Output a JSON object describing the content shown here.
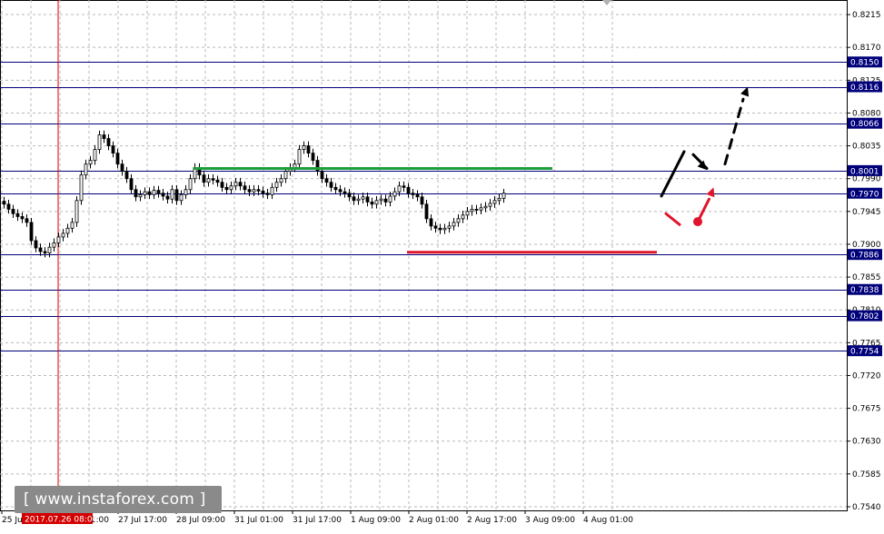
{
  "chart_data": {
    "type": "candlestick",
    "instrument": "",
    "ylim": [
      0.7535,
      0.8235
    ],
    "x_tick_labels": [
      "25 Jul 2017",
      "27 Jul 01:00",
      "27 Jul 17:00",
      "28 Jul 09:00",
      "31 Jul 01:00",
      "31 Jul 17:00",
      "1 Aug 09:00",
      "2 Aug 01:00",
      "2 Aug 17:00",
      "3 Aug 09:00",
      "4 Aug 01:00"
    ],
    "y_tick_labels": [
      "0.8215",
      "0.8170",
      "0.8125",
      "0.8080",
      "0.8035",
      "0.7990",
      "0.7945",
      "0.7900",
      "0.7855",
      "0.7810",
      "0.7765",
      "0.7720",
      "0.7675",
      "0.7630",
      "0.7585",
      "0.7540"
    ],
    "level_labels": [
      "0.8150",
      "0.8116",
      "0.8066",
      "0.8001",
      "0.7970",
      "0.7886",
      "0.7838",
      "0.7802",
      "0.7754"
    ],
    "cursor_time_label": "2017.07.26 08:00",
    "price_series": [
      0.7955,
      0.7948,
      0.7942,
      0.7938,
      0.7935,
      0.793,
      0.7905,
      0.7895,
      0.789,
      0.7888,
      0.7896,
      0.7902,
      0.791,
      0.7915,
      0.7922,
      0.793,
      0.796,
      0.7995,
      0.801,
      0.8015,
      0.803,
      0.805,
      0.8045,
      0.8035,
      0.8025,
      0.801,
      0.8,
      0.799,
      0.7975,
      0.7965,
      0.7968,
      0.7972,
      0.7968,
      0.7974,
      0.797,
      0.7966,
      0.7962,
      0.7975,
      0.796,
      0.7968,
      0.7975,
      0.799,
      0.8005,
      0.7995,
      0.7985,
      0.799,
      0.7988,
      0.7985,
      0.7978,
      0.7975,
      0.798,
      0.7985,
      0.798,
      0.7975,
      0.7972,
      0.7975,
      0.7973,
      0.797,
      0.7968,
      0.7978,
      0.7985,
      0.799,
      0.8,
      0.8005,
      0.801,
      0.803,
      0.8035,
      0.8025,
      0.8015,
      0.8,
      0.799,
      0.7985,
      0.7978,
      0.7975,
      0.7972,
      0.797,
      0.7965,
      0.796,
      0.7962,
      0.7965,
      0.7958,
      0.7955,
      0.796,
      0.7962,
      0.7958,
      0.7966,
      0.7972,
      0.798,
      0.7978,
      0.797,
      0.7968,
      0.7965,
      0.7955,
      0.7935,
      0.7925,
      0.7922,
      0.792,
      0.7922,
      0.7925,
      0.793,
      0.7935,
      0.794,
      0.7945,
      0.7948,
      0.7947,
      0.795,
      0.7952,
      0.7956,
      0.796,
      0.7963,
      0.797
    ],
    "horizontal_levels": [
      {
        "price": 0.815,
        "color": "#00007a"
      },
      {
        "price": 0.8116,
        "color": "#00007a"
      },
      {
        "price": 0.8066,
        "color": "#00007a"
      },
      {
        "price": 0.8001,
        "color": "#00007a"
      },
      {
        "price": 0.797,
        "color": "#00007a"
      },
      {
        "price": 0.7886,
        "color": "#00007a"
      },
      {
        "price": 0.7838,
        "color": "#00007a"
      },
      {
        "price": 0.7802,
        "color": "#00007a"
      },
      {
        "price": 0.7754,
        "color": "#00007a"
      }
    ],
    "support_resistance": [
      {
        "kind": "resistance",
        "price": 0.8004,
        "from_index": 42,
        "to_index": 121,
        "color": "#1e9e3a"
      },
      {
        "kind": "support",
        "price": 0.7889,
        "from_index": 89,
        "to_index": 144,
        "color": "#e0152c"
      }
    ],
    "colors": {
      "bull_candle": "#ffffff",
      "bear_candle": "#000000",
      "level_label_bg": "#00007a",
      "grid": "#b9b9b9",
      "cursor_line": "#d40000",
      "scenario_up": "#000000",
      "scenario_alt": "#e0152c"
    },
    "grid": true,
    "watermark": "[ www.instaforex.com ]"
  }
}
